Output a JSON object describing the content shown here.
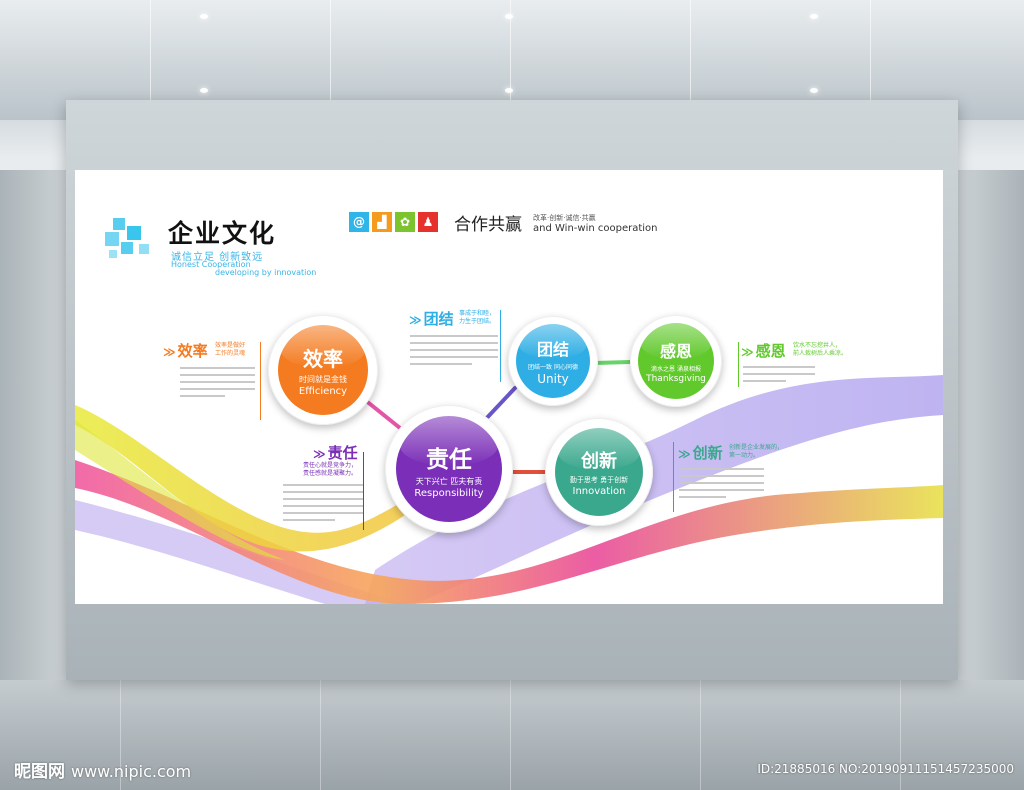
{
  "header": {
    "title": "企业文化",
    "subtitle_cn": "诚信立足  创新致远",
    "subtitle_en_1": "Honest Cooperation",
    "subtitle_en_2": "developing by innovation",
    "slogan_cn": "合作共赢",
    "slogan_small": "改革·创新·诚信·共赢",
    "slogan_en": "and Win-win  cooperation",
    "icons": [
      {
        "name": "at-icon",
        "glyph": "@",
        "color": "#2fb5e8"
      },
      {
        "name": "chart-icon",
        "glyph": "▟",
        "color": "#f39a1f"
      },
      {
        "name": "flower-icon",
        "glyph": "✿",
        "color": "#7cc42e"
      },
      {
        "name": "person-icon",
        "glyph": "♟",
        "color": "#e5322d"
      }
    ]
  },
  "circles": {
    "efficiency": {
      "cn": "效率",
      "sub": "时间就是金钱",
      "en": "Efficiency",
      "color": "#f47b20"
    },
    "responsibility": {
      "cn": "责任",
      "sub": "天下兴亡  匹夫有责",
      "en": "Responsibility",
      "color": "#7b2fb8"
    },
    "unity": {
      "cn": "团结",
      "sub": "团结一致  同心同德",
      "en": "Unity",
      "color": "#2eaee4"
    },
    "thanksgiving": {
      "cn": "感恩",
      "sub": "滴水之恩  涌泉相报",
      "en": "Thanksgiving",
      "color": "#62c92d"
    },
    "innovation": {
      "cn": "创新",
      "sub": "勤于思考  勇于创新",
      "en": "Innovation",
      "color": "#3aa88d"
    }
  },
  "sections": {
    "efficiency": {
      "arrow": "≫",
      "title": "效率",
      "note": "效率是做好\n工作的灵魂",
      "color": "#f47b20"
    },
    "unity": {
      "arrow": "≫",
      "title": "团结",
      "note": "事成于和睦，\n力生于团结。",
      "color": "#2eaee4"
    },
    "responsibility": {
      "arrow": "≫",
      "title": "责任",
      "note": "责任心就是竞争力，\n责任感就是凝聚力。",
      "color": "#7b2fb8"
    },
    "thanksgiving": {
      "arrow": "≫",
      "title": "感恩",
      "note": "饮水不忘挖井人，\n前人栽树后人乘凉。",
      "color": "#62c92d"
    },
    "innovation": {
      "arrow": "≫",
      "title": "创新",
      "note": "创新是企业发展的，\n第一动力。",
      "color": "#3aa88d"
    }
  },
  "watermark": {
    "site_cn": "昵图网",
    "site_url": "www.nipic.com",
    "id_text": "ID:21885016 NO:20190911151457235000"
  }
}
